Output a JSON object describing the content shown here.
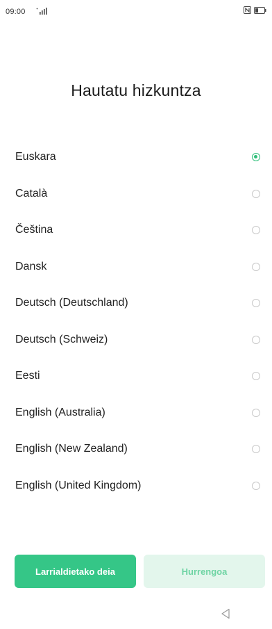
{
  "status_bar": {
    "time": "09:00",
    "icons": [
      "signal-icon",
      "nfc-icon",
      "battery-icon"
    ]
  },
  "title": "Hautatu hizkuntza",
  "languages": [
    {
      "label": "Euskara",
      "selected": true
    },
    {
      "label": "Català",
      "selected": false
    },
    {
      "label": "Čeština",
      "selected": false
    },
    {
      "label": "Dansk",
      "selected": false
    },
    {
      "label": "Deutsch (Deutschland)",
      "selected": false
    },
    {
      "label": "Deutsch (Schweiz)",
      "selected": false
    },
    {
      "label": "Eesti",
      "selected": false
    },
    {
      "label": "English (Australia)",
      "selected": false
    },
    {
      "label": "English (New Zealand)",
      "selected": false
    },
    {
      "label": "English (United Kingdom)",
      "selected": false
    }
  ],
  "buttons": {
    "emergency_label": "Larrialdietako deia",
    "next_label": "Hurrengoa"
  },
  "colors": {
    "accent": "#35c687",
    "accent_light": "#e3f6ec",
    "accent_text_disabled": "#6fd4a4"
  },
  "nav": {
    "back_icon": "back-triangle-icon"
  }
}
